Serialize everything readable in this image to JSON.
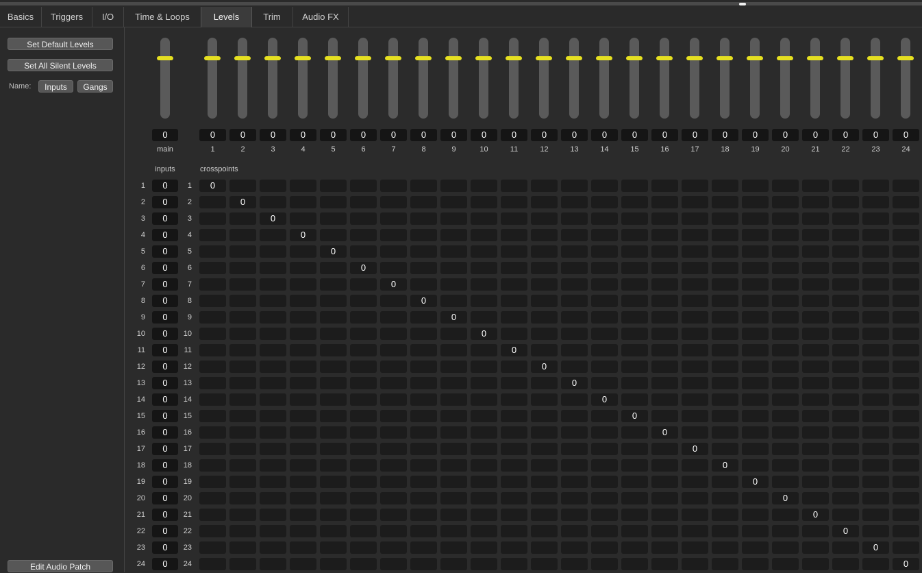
{
  "tabs": [
    {
      "label": "Basics"
    },
    {
      "label": "Triggers"
    },
    {
      "label": "I/O"
    },
    {
      "label": "Time & Loops"
    },
    {
      "label": "Levels"
    },
    {
      "label": "Trim"
    },
    {
      "label": "Audio FX"
    }
  ],
  "active_tab": "Levels",
  "sidebar": {
    "set_default_label": "Set Default Levels",
    "set_silent_label": "Set All Silent Levels",
    "name_label": "Name:",
    "inputs_label": "Inputs",
    "gangs_label": "Gangs",
    "edit_patch_label": "Edit Audio Patch"
  },
  "accent_color": "#e6e021",
  "main_fader": {
    "label": "main",
    "value": "0",
    "level": 0
  },
  "output_faders": [
    {
      "label": "1",
      "value": "0"
    },
    {
      "label": "2",
      "value": "0"
    },
    {
      "label": "3",
      "value": "0"
    },
    {
      "label": "4",
      "value": "0"
    },
    {
      "label": "5",
      "value": "0"
    },
    {
      "label": "6",
      "value": "0"
    },
    {
      "label": "7",
      "value": "0"
    },
    {
      "label": "8",
      "value": "0"
    },
    {
      "label": "9",
      "value": "0"
    },
    {
      "label": "10",
      "value": "0"
    },
    {
      "label": "11",
      "value": "0"
    },
    {
      "label": "12",
      "value": "0"
    },
    {
      "label": "13",
      "value": "0"
    },
    {
      "label": "14",
      "value": "0"
    },
    {
      "label": "15",
      "value": "0"
    },
    {
      "label": "16",
      "value": "0"
    },
    {
      "label": "17",
      "value": "0"
    },
    {
      "label": "18",
      "value": "0"
    },
    {
      "label": "19",
      "value": "0"
    },
    {
      "label": "20",
      "value": "0"
    },
    {
      "label": "21",
      "value": "0"
    },
    {
      "label": "22",
      "value": "0"
    },
    {
      "label": "23",
      "value": "0"
    },
    {
      "label": "24",
      "value": "0"
    }
  ],
  "inputs_header": "inputs",
  "crosspoints_header": "crosspoints",
  "input_rows": [
    {
      "label": "1",
      "value": "0"
    },
    {
      "label": "2",
      "value": "0"
    },
    {
      "label": "3",
      "value": "0"
    },
    {
      "label": "4",
      "value": "0"
    },
    {
      "label": "5",
      "value": "0"
    },
    {
      "label": "6",
      "value": "0"
    },
    {
      "label": "7",
      "value": "0"
    },
    {
      "label": "8",
      "value": "0"
    },
    {
      "label": "9",
      "value": "0"
    },
    {
      "label": "10",
      "value": "0"
    },
    {
      "label": "11",
      "value": "0"
    },
    {
      "label": "12",
      "value": "0"
    },
    {
      "label": "13",
      "value": "0"
    },
    {
      "label": "14",
      "value": "0"
    },
    {
      "label": "15",
      "value": "0"
    },
    {
      "label": "16",
      "value": "0"
    },
    {
      "label": "17",
      "value": "0"
    },
    {
      "label": "18",
      "value": "0"
    },
    {
      "label": "19",
      "value": "0"
    },
    {
      "label": "20",
      "value": "0"
    },
    {
      "label": "21",
      "value": "0"
    },
    {
      "label": "22",
      "value": "0"
    },
    {
      "label": "23",
      "value": "0"
    },
    {
      "label": "24",
      "value": "0"
    }
  ],
  "crosspoint_diagonal_value": "0"
}
